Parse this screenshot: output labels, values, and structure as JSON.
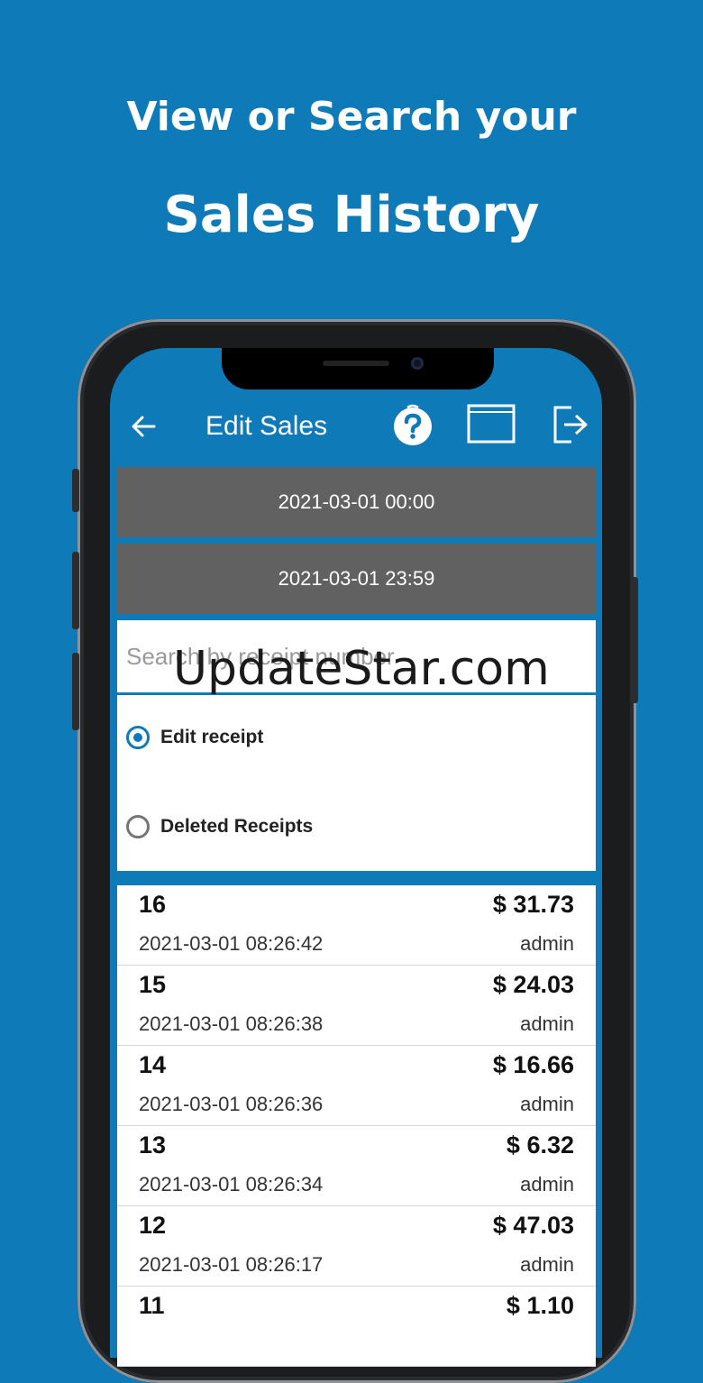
{
  "headline": {
    "line1": "View or Search your",
    "line2": "Sales History"
  },
  "appbar": {
    "title": "Edit Sales"
  },
  "dates": {
    "start": "2021-03-01 00:00",
    "end": "2021-03-01 23:59"
  },
  "search": {
    "placeholder": "Search by receipt number",
    "value": ""
  },
  "watermark": "UpdateStar.com",
  "options": [
    {
      "label": "Edit receipt",
      "selected": true
    },
    {
      "label": "Deleted Receipts",
      "selected": false
    }
  ],
  "receipts": [
    {
      "number": "16",
      "amount": "$ 31.73",
      "datetime": "2021-03-01 08:26:42",
      "user": "admin"
    },
    {
      "number": "15",
      "amount": "$ 24.03",
      "datetime": "2021-03-01 08:26:38",
      "user": "admin"
    },
    {
      "number": "14",
      "amount": "$ 16.66",
      "datetime": "2021-03-01 08:26:36",
      "user": "admin"
    },
    {
      "number": "13",
      "amount": "$ 6.32",
      "datetime": "2021-03-01 08:26:34",
      "user": "admin"
    },
    {
      "number": "12",
      "amount": "$ 47.03",
      "datetime": "2021-03-01 08:26:17",
      "user": "admin"
    },
    {
      "number": "11",
      "amount": "$ 1.10",
      "datetime": "",
      "user": ""
    }
  ],
  "colors": {
    "primary": "#0e7ab8",
    "date_bar": "#616161"
  }
}
